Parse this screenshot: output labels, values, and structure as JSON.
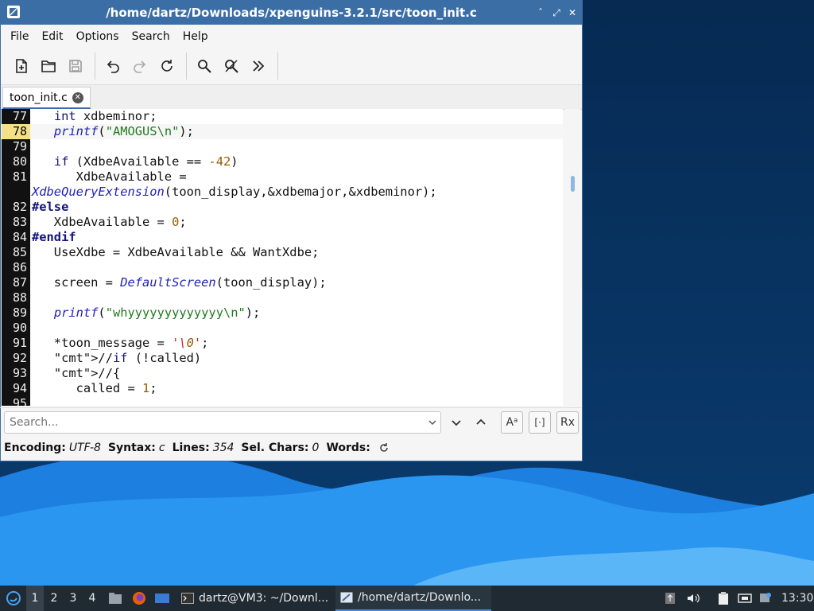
{
  "window": {
    "title": "/home/dartz/Downloads/xpenguins-3.2.1/src/toon_init.c",
    "controls": [
      "ˆ",
      "⤢",
      "✕"
    ]
  },
  "menu": [
    "File",
    "Edit",
    "Options",
    "Search",
    "Help"
  ],
  "toolbar": {
    "icons": [
      "new-file-icon",
      "open-folder-icon",
      "save-icon",
      "undo-icon",
      "redo-icon",
      "reload-icon",
      "find-icon",
      "replace-icon",
      "more-icon"
    ]
  },
  "tab": {
    "label": "toon_init.c",
    "close": "✕"
  },
  "editor": {
    "current_line": "78",
    "lines": [
      {
        "n": "77",
        "code": "   int xdbeminor;"
      },
      {
        "n": "78",
        "code": "   printf(\"AMOGUS\\n\");"
      },
      {
        "n": "79",
        "code": ""
      },
      {
        "n": "80",
        "code": "   if (XdbeAvailable == -42)"
      },
      {
        "n": "81",
        "code": "      XdbeAvailable ="
      },
      {
        "n": "",
        "code": "XdbeQueryExtension(toon_display,&xdbemajor,&xdbeminor);"
      },
      {
        "n": "82",
        "code": "#else"
      },
      {
        "n": "83",
        "code": "   XdbeAvailable = 0;"
      },
      {
        "n": "84",
        "code": "#endif"
      },
      {
        "n": "85",
        "code": "   UseXdbe = XdbeAvailable && WantXdbe;"
      },
      {
        "n": "86",
        "code": ""
      },
      {
        "n": "87",
        "code": "   screen = DefaultScreen(toon_display);"
      },
      {
        "n": "88",
        "code": ""
      },
      {
        "n": "89",
        "code": "   printf(\"whyyyyyyyyyyyyy\\n\");"
      },
      {
        "n": "90",
        "code": ""
      },
      {
        "n": "91",
        "code": "   *toon_message = '\\0';"
      },
      {
        "n": "92",
        "code": "   //if (!called)"
      },
      {
        "n": "93",
        "code": "   //{"
      },
      {
        "n": "94",
        "code": "      called = 1;"
      },
      {
        "n": "95",
        "code": ""
      }
    ]
  },
  "search": {
    "placeholder": "Search...",
    "match_case_label": "Aᵃ",
    "whole_word_label": "[·]",
    "regex_label": "Rx"
  },
  "status": {
    "encoding_label": "Encoding:",
    "encoding_value": "UTF-8",
    "syntax_label": "Syntax:",
    "syntax_value": "c",
    "lines_label": "Lines:",
    "lines_value": "354",
    "sel_label": "Sel. Chars:",
    "sel_value": "0",
    "words_label": "Words:"
  },
  "taskbar": {
    "workspaces": [
      "1",
      "2",
      "3",
      "4"
    ],
    "tasks": [
      "dartz@VM3: ~/Downl...",
      "/home/dartz/Downlo..."
    ],
    "clock": "13:30"
  },
  "colors": {
    "titlebar": "#3b6ea5",
    "taskbar": "#1f2a33",
    "current_line_number": "#f5e08a"
  }
}
